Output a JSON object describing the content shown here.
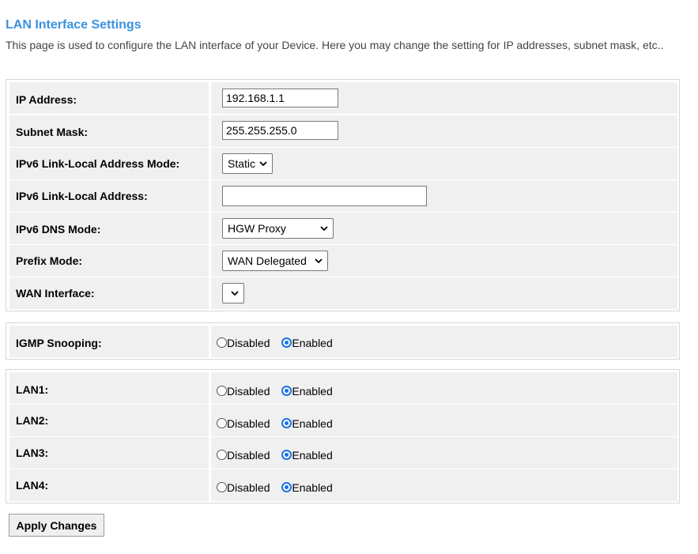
{
  "header": {
    "title": "LAN Interface Settings",
    "description": "This page is used to configure the LAN interface of your Device. Here you may change the setting for IP addresses, subnet mask, etc.."
  },
  "lan_settings": {
    "ip_address": {
      "label": "IP Address:",
      "value": "192.168.1.1"
    },
    "subnet_mask": {
      "label": "Subnet Mask:",
      "value": "255.255.255.0"
    },
    "ipv6_link_local_mode": {
      "label": "IPv6 Link-Local Address Mode:",
      "selected": "Static"
    },
    "ipv6_link_local_address": {
      "label": "IPv6 Link-Local Address:",
      "value": ""
    },
    "ipv6_dns_mode": {
      "label": "IPv6 DNS Mode:",
      "selected": "HGW Proxy"
    },
    "prefix_mode": {
      "label": "Prefix Mode:",
      "selected": "WAN Delegated"
    },
    "wan_interface": {
      "label": "WAN Interface:",
      "selected": ""
    }
  },
  "igmp": {
    "label": "IGMP Snooping:",
    "disabled_label": "Disabled",
    "enabled_label": "Enabled",
    "selected": "Enabled"
  },
  "ports": [
    {
      "label": "LAN1:",
      "disabled_label": "Disabled",
      "enabled_label": "Enabled",
      "selected": "Enabled"
    },
    {
      "label": "LAN2:",
      "disabled_label": "Disabled",
      "enabled_label": "Enabled",
      "selected": "Enabled"
    },
    {
      "label": "LAN3:",
      "disabled_label": "Disabled",
      "enabled_label": "Enabled",
      "selected": "Enabled"
    },
    {
      "label": "LAN4:",
      "disabled_label": "Disabled",
      "enabled_label": "Enabled",
      "selected": "Enabled"
    }
  ],
  "actions": {
    "apply_label": "Apply Changes"
  }
}
